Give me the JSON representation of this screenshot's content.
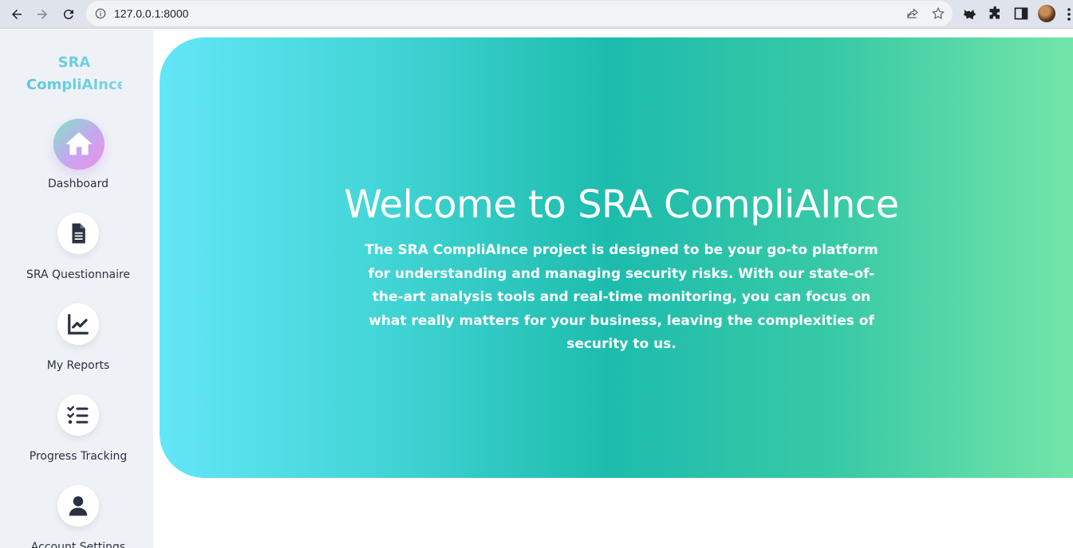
{
  "browser": {
    "url": "127.0.0.1:8000"
  },
  "sidebar": {
    "brand": "SRA CompliAInce",
    "items": [
      {
        "label": "Dashboard",
        "icon": "home-icon",
        "active": true
      },
      {
        "label": "SRA Questionnaire",
        "icon": "document-icon",
        "active": false
      },
      {
        "label": "My Reports",
        "icon": "chart-line-icon",
        "active": false
      },
      {
        "label": "Progress Tracking",
        "icon": "checklist-icon",
        "active": false
      },
      {
        "label": "Account Settings",
        "icon": "user-icon",
        "active": false
      }
    ]
  },
  "hero": {
    "title": "Welcome to SRA CompliAInce",
    "text": "The SRA CompliAInce project is designed to be your go-to platform for understanding and managing security risks. With our state-of-the-art analysis tools and real-time monitoring, you can focus on what really matters for your business, leaving the complexities of security to us."
  },
  "colors": {
    "hero_gradient": [
      "#63e6f7",
      "#1dbcad",
      "#7eeaa9"
    ],
    "sidebar_bg": "#eef2f7",
    "brand": "#5bc8d9",
    "icon": "#2b3140"
  }
}
